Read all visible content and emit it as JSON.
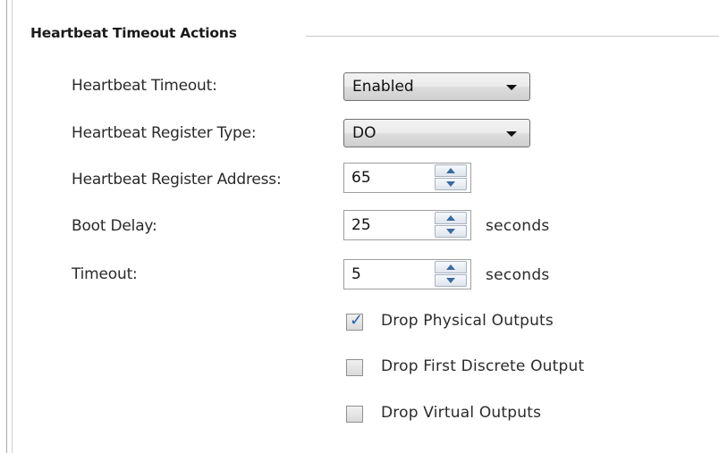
{
  "group": {
    "title": "Heartbeat Timeout Actions"
  },
  "fields": {
    "heartbeat_timeout": {
      "label": "Heartbeat Timeout:",
      "value": "Enabled"
    },
    "register_type": {
      "label": "Heartbeat Register Type:",
      "value": "DO"
    },
    "register_address": {
      "label": "Heartbeat Register Address:",
      "value": "65"
    },
    "boot_delay": {
      "label": "Boot Delay:",
      "value": "25",
      "unit": "seconds"
    },
    "timeout": {
      "label": "Timeout:",
      "value": "5",
      "unit": "seconds"
    }
  },
  "checkboxes": [
    {
      "label": "Drop Physical Outputs",
      "checked": true
    },
    {
      "label": "Drop First Discrete Output",
      "checked": false
    },
    {
      "label": "Drop Virtual Outputs",
      "checked": false
    }
  ],
  "icons": {
    "dropdown": "chevron-down-icon",
    "spin_up": "arrow-up-icon",
    "spin_down": "arrow-down-icon",
    "check": "checkmark-icon"
  },
  "colors": {
    "check_accent": "#2b5fa6",
    "spin_arrow": "#3a6aa0"
  }
}
